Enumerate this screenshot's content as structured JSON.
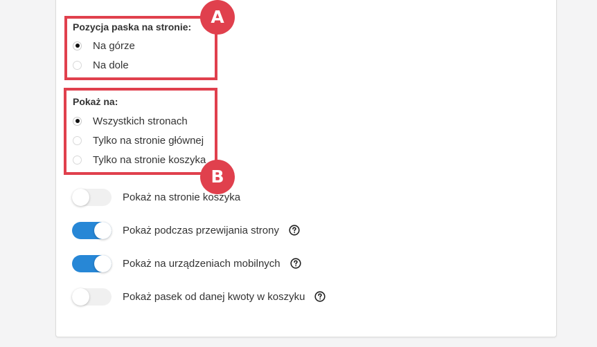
{
  "annotations": {
    "a_label": "A",
    "b_label": "B",
    "color": "#e0404d"
  },
  "position_group": {
    "title": "Pozycja paska na stronie:",
    "options": [
      {
        "label": "Na górze",
        "selected": true
      },
      {
        "label": "Na dole",
        "selected": false
      }
    ]
  },
  "show_group": {
    "title": "Pokaż na:",
    "options": [
      {
        "label": "Wszystkich stronach",
        "selected": true
      },
      {
        "label": "Tylko na stronie głównej",
        "selected": false
      },
      {
        "label": "Tylko na stronie koszyka",
        "selected": false
      }
    ]
  },
  "toggles": [
    {
      "label": "Pokaż na stronie koszyka",
      "on": false,
      "help_icon": false
    },
    {
      "label": "Pokaż podczas przewijania strony",
      "on": true,
      "help_icon": true
    },
    {
      "label": "Pokaż na urządzeniach mobilnych",
      "on": true,
      "help_icon": true
    },
    {
      "label": "Pokaż pasek od danej kwoty w koszyku",
      "on": false,
      "help_icon": true
    }
  ],
  "colors": {
    "toggle_on": "#2787d6",
    "toggle_off": "#f0f0f0"
  }
}
